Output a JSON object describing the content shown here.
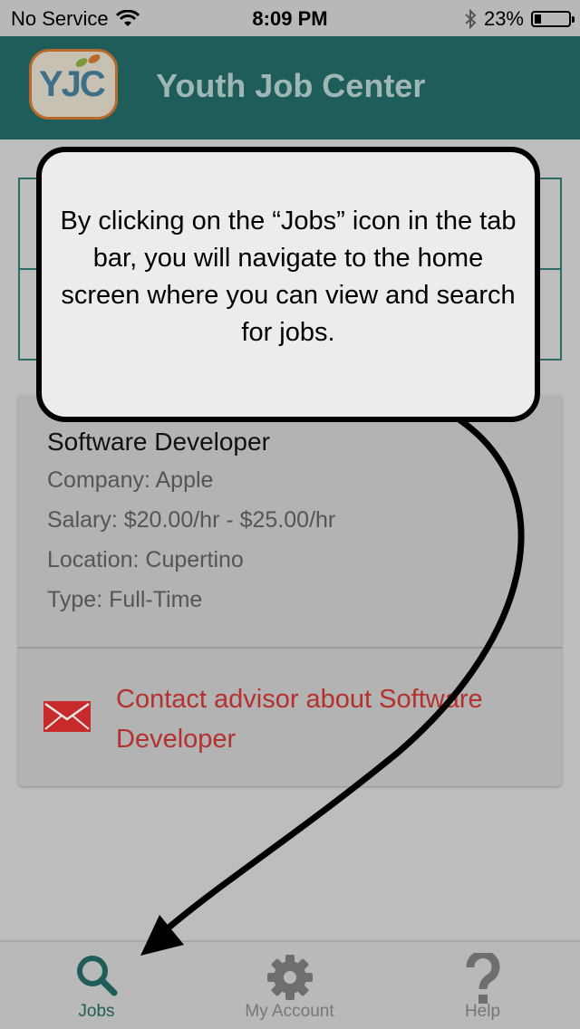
{
  "status_bar": {
    "carrier": "No Service",
    "time": "8:09 PM",
    "battery_percent": "23%",
    "battery_level": 0.23
  },
  "header": {
    "logo_text": "YJC",
    "title": "Youth Job Center",
    "color": "#1f5d5a"
  },
  "job": {
    "title": "Software Developer",
    "company": "Company: Apple",
    "salary": "Salary: $20.00/hr - $25.00/hr",
    "location": "Location: Cupertino",
    "type": "Type: Full-Time",
    "contact_label": "Contact advisor about Software Developer",
    "contact_color": "#b3312e"
  },
  "tabs": [
    {
      "label": "Jobs",
      "icon": "search-icon",
      "active": true
    },
    {
      "label": "My Account",
      "icon": "gear-icon",
      "active": false
    },
    {
      "label": "Help",
      "icon": "question-icon",
      "active": false
    }
  ],
  "coach_mark": {
    "text": "By clicking on the “Jobs” icon in the tab bar, you will navigate to the home screen where you can view and search for jobs."
  }
}
